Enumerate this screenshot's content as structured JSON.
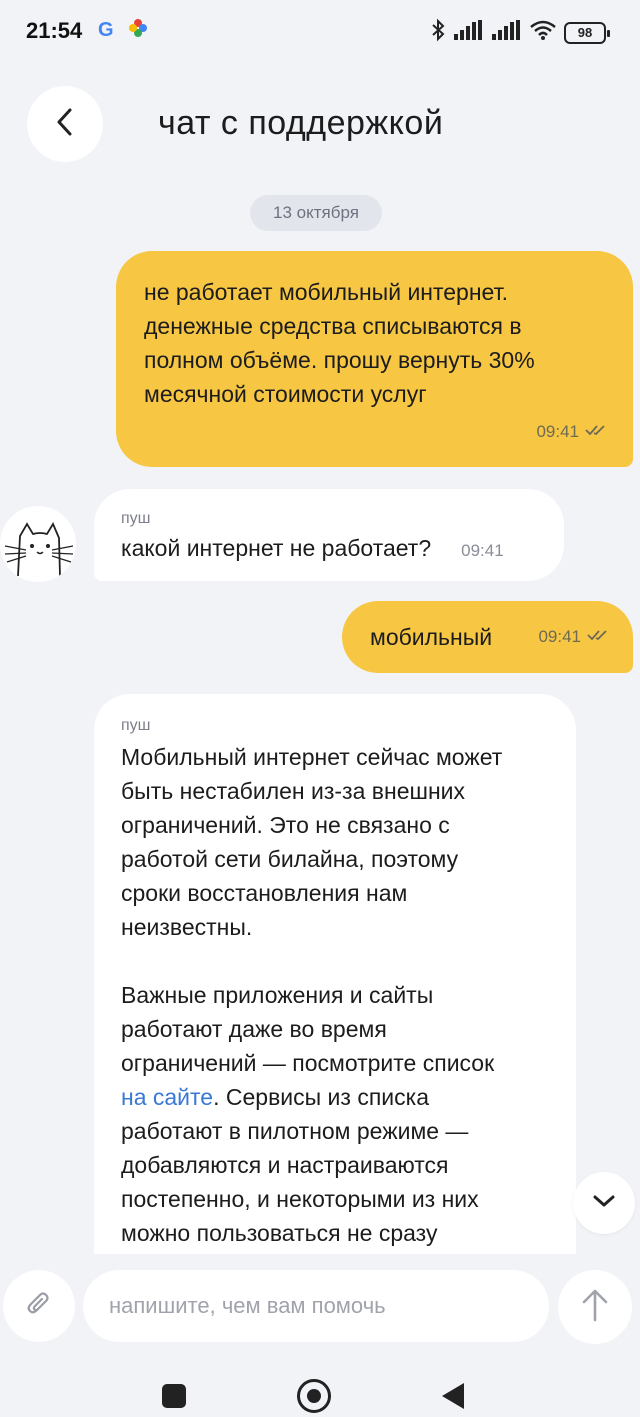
{
  "status_bar": {
    "time": "21:54",
    "google_letter": "G",
    "battery": "98",
    "icons": [
      "google-icon",
      "pinwheel-icon",
      "bluetooth-icon",
      "signal-icon",
      "signal-icon",
      "wifi-icon",
      "battery-icon"
    ]
  },
  "header": {
    "title": "чат с поддержкой",
    "back_icon": "chevron-left-icon"
  },
  "date_separator": "13 октября",
  "messages": [
    {
      "direction": "outgoing",
      "lines": [
        "не работает мобильный интернет.",
        "денежные средства списываются в",
        "полном объёме. прошу вернуть 30%",
        "месячной стоимости услуг"
      ],
      "time": "09:41",
      "status_icon": "double-check-icon"
    },
    {
      "direction": "incoming",
      "sender": "пуш",
      "text": "какой интернет не работает?",
      "time": "09:41"
    },
    {
      "direction": "outgoing",
      "text": "мобильный",
      "time": "09:41",
      "status_icon": "double-check-icon"
    },
    {
      "direction": "incoming",
      "sender": "пуш",
      "paragraph1": [
        "Мобильный интернет сейчас может",
        "быть нестабилен из-за внешних",
        "ограничений. Это не связано с",
        "работой сети билайна, поэтому",
        "сроки восстановления нам",
        "неизвестны."
      ],
      "paragraph2_lines_before_link": [
        "Важные приложения и сайты",
        "работают даже во время",
        "ограничений — посмотрите список"
      ],
      "link_text": "на сайте",
      "after_link": ". Сервисы из списка",
      "paragraph2_lines_after": [
        "работают в пилотном режиме —",
        "добавляются и настраиваются",
        "постепенно, и некоторыми из них",
        "можно пользоваться не сразу"
      ]
    }
  ],
  "input": {
    "placeholder": "напишите, чем вам помочь",
    "value": ""
  },
  "colors": {
    "outgoing_bubble": "#f7c743",
    "incoming_bubble": "#ffffff",
    "background": "#f2f3f7",
    "link": "#3a78d6"
  }
}
